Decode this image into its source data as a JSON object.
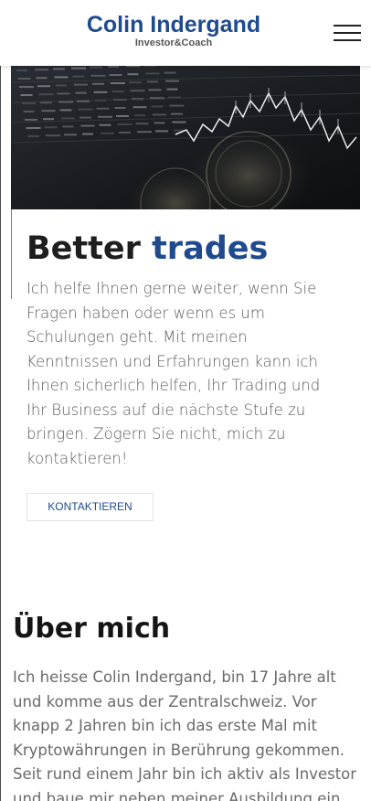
{
  "header": {
    "brand_name": "Colin Indergand",
    "brand_tagline": "Investor&Coach",
    "menu_icon": "hamburger-menu-icon"
  },
  "hero": {
    "image_subject": "trading-chart-screen-photo",
    "title_part1": "Better",
    "title_part2": "trades",
    "text": "Ich helfe Ihnen gerne weiter, wenn Sie Fragen haben oder wenn es um Schulungen geht. Mit meinen Kenntnissen und Erfahrungen kann ich Ihnen sicherlich helfen, Ihr Trading und Ihr Business auf die nächste Stufe zu bringen. Zögern Sie nicht, mich zu kontaktieren!",
    "cta_label": "KONTAKTIEREN"
  },
  "about": {
    "title": "Über mich",
    "text": "Ich heisse Colin Indergand, bin 17 Jahre alt und komme aus der Zentralschweiz. Vor knapp 2 Jahren bin ich das erste Mal mit Kryptowährungen in Berührung gekommen. Seit rund einem Jahr bin ich aktiv als Investor und baue mir neben meiner Ausbildung ein"
  },
  "colors": {
    "brand": "#1f4a8e",
    "heading": "#1e1e1e",
    "body_text": "#5a5a5a"
  }
}
